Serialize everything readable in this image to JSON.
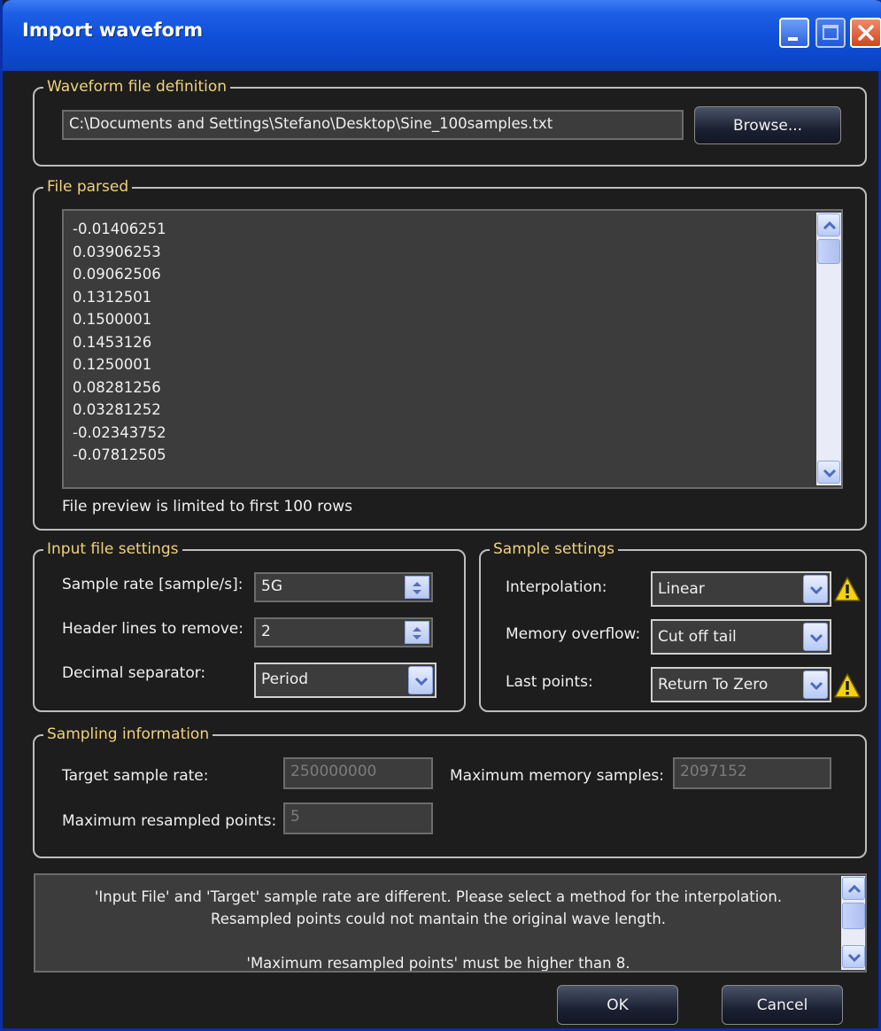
{
  "window": {
    "title": "Import waveform"
  },
  "waveform_file": {
    "group_label": "Waveform file definition",
    "path": "C:\\Documents and Settings\\Stefano\\Desktop\\Sine_100samples.txt",
    "browse_label": "Browse..."
  },
  "file_parsed": {
    "group_label": "File parsed",
    "rows": [
      "-0.01406251",
      "0.03906253",
      "0.09062506",
      "0.1312501",
      "0.1500001",
      "0.1453126",
      "0.1250001",
      "0.08281256",
      "0.03281252",
      "-0.02343752",
      "-0.07812505"
    ],
    "preview_note": "File preview is limited to first 100 rows"
  },
  "input_file_settings": {
    "group_label": "Input file settings",
    "sample_rate_label": "Sample rate [sample/s]:",
    "sample_rate_value": "5G",
    "header_lines_label": "Header lines to remove:",
    "header_lines_value": "2",
    "decimal_separator_label": "Decimal separator:",
    "decimal_separator_value": "Period"
  },
  "sample_settings": {
    "group_label": "Sample settings",
    "interpolation_label": "Interpolation:",
    "interpolation_value": "Linear",
    "memory_overflow_label": "Memory overflow:",
    "memory_overflow_value": "Cut off tail",
    "last_points_label": "Last points:",
    "last_points_value": "Return To Zero"
  },
  "sampling_information": {
    "group_label": "Sampling information",
    "target_sample_rate_label": "Target sample rate:",
    "target_sample_rate_value": "250000000",
    "max_memory_samples_label": "Maximum memory samples:",
    "max_memory_samples_value": "2097152",
    "max_resampled_points_label": "Maximum resampled points:",
    "max_resampled_points_value": "5"
  },
  "messages": {
    "lines": [
      "'Input File' and 'Target' sample rate are different. Please select a method for the interpolation.",
      "Resampled points could not mantain the original wave length.",
      "",
      "'Maximum resampled points' must be higher than 8."
    ]
  },
  "footer": {
    "ok_label": "OK",
    "cancel_label": "Cancel"
  },
  "icons": {
    "minimize": "minimize-icon",
    "maximize": "maximize-icon",
    "close": "close-icon",
    "warning": "warning-icon",
    "spin": "spin-arrows-icon",
    "dropdown": "chevron-down-icon"
  },
  "colors": {
    "titlebar": "#0f4fd8",
    "background": "#1d1d1d",
    "group_label": "#f0d27a",
    "field_bg": "#3c3c3c",
    "readonly_text": "#7c7c7c",
    "warning": "#f5d20a"
  }
}
